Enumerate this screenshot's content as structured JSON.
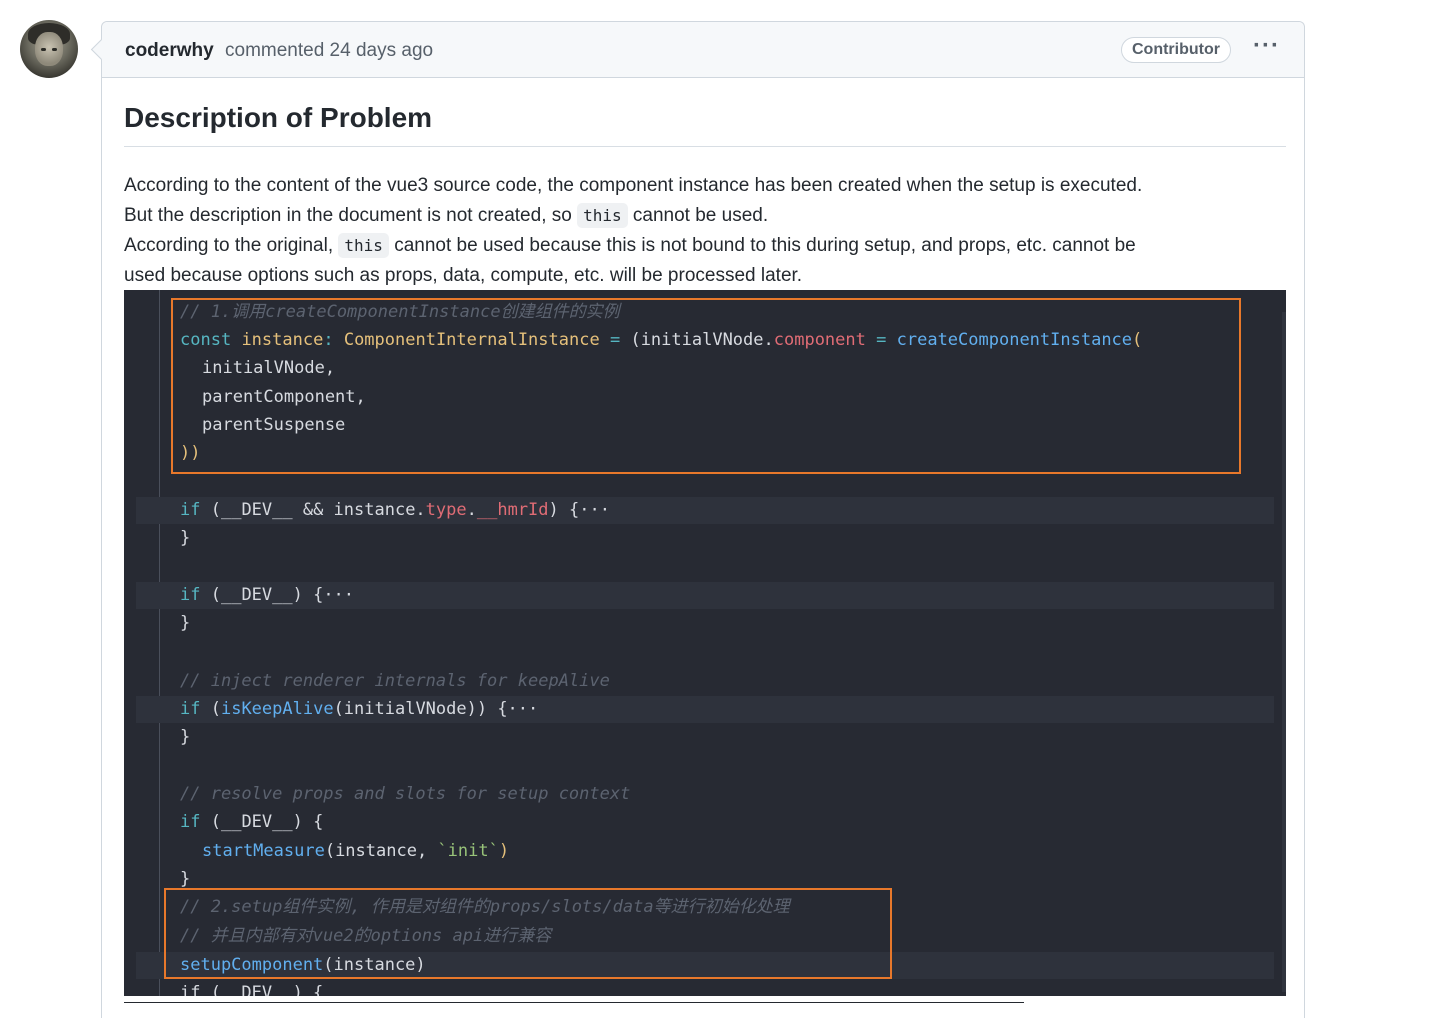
{
  "comment": {
    "author": "coderwhy",
    "meta": "commented 24 days ago",
    "badge": "Contributor",
    "more": "···"
  },
  "body": {
    "title": "Description of Problem",
    "p1_before": "According to the content of the vue3 source code, the component instance has been created when the setup is executed.",
    "p2_before": "But the description in the document is not created, so ",
    "p2_code": "this",
    "p2_after": " cannot be used.",
    "p3_before": "According to the original, ",
    "p3_code": "this",
    "p3_after": " cannot be used because this is not bound to this during setup, and props, etc. cannot be",
    "p4": "used because options such as props, data, compute, etc. will be processed later."
  },
  "code_lines": {
    "l1": "// 1.调用createComponentInstance创建组件的实例",
    "l2_const": "const",
    "l2_inst": "instance",
    "l2_type": "ComponentInternalInstance",
    "l2_mid": "(initialVNode.",
    "l2_prop": "component",
    "l2_fn": "createComponentInstance",
    "l3": "initialVNode,",
    "l4": "parentComponent,",
    "l5": "parentSuspense",
    "l6": "))",
    "l8_if": "if",
    "l8_rest": "(__DEV__ && instance.",
    "l8_type": "type",
    "l8_hmr": "__hmrId",
    "l8_end": ") {···",
    "close": "}",
    "l11_rest": "(__DEV__) {···",
    "c_inject": "// inject renderer internals for keepAlive",
    "l15_fn": "isKeepAlive",
    "l15_rest": "(initialVNode)) {···",
    "c_resolve": "// resolve props and slots for setup context",
    "l19_rest": "(__DEV__) {",
    "l20_fn": "startMeasure",
    "l20_arg": "(instance, ",
    "l20_str": "`init`",
    "c_setup1": "// 2.setup组件实例, 作用是对组件的props/slots/data等进行初始化处理",
    "c_setup2": "// 并且内部有对vue2的options api进行兼容",
    "l24_fn": "setupComponent",
    "l24_arg": "(instance)",
    "l25": "if (__DEV__) {"
  }
}
